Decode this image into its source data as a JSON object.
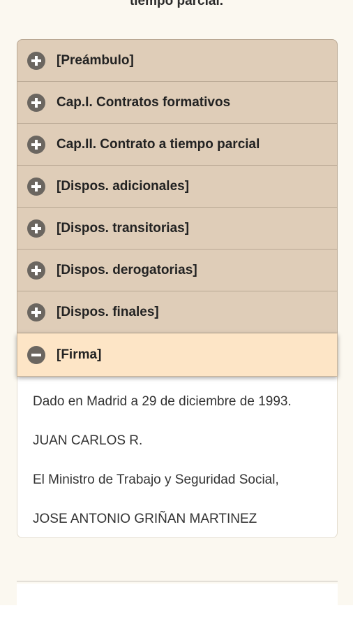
{
  "header": {
    "top_text": "tiempo parcial."
  },
  "accordion": {
    "items": [
      {
        "label": "[Preámbulo]",
        "icon": "plus-circle-icon"
      },
      {
        "label": "Cap.I. Contratos formativos",
        "icon": "plus-circle-icon"
      },
      {
        "label": "Cap.II. Contrato a tiempo parcial",
        "icon": "plus-circle-icon"
      },
      {
        "label": "[Dispos. adicionales]",
        "icon": "plus-circle-icon"
      },
      {
        "label": "[Dispos. transitorias]",
        "icon": "plus-circle-icon"
      },
      {
        "label": "[Dispos. derogatorias]",
        "icon": "plus-circle-icon"
      },
      {
        "label": "[Dispos. finales]",
        "icon": "plus-circle-icon"
      },
      {
        "label": "[Firma]",
        "icon": "minus-circle-icon",
        "expanded": true
      }
    ],
    "expanded_content": {
      "line1": "Dado en Madrid a 29 de diciembre de 1993.",
      "line2": "JUAN CARLOS R.",
      "line3": "El Ministro de Trabajo y Seguridad Social,",
      "line4": "JOSE ANTONIO GRIÑAN MARTINEZ"
    }
  },
  "colors": {
    "page_background": "#fbf8f0",
    "item_background": "#dfcdb8",
    "active_item_background": "#fde5c6",
    "icon_color": "#6b6660"
  }
}
